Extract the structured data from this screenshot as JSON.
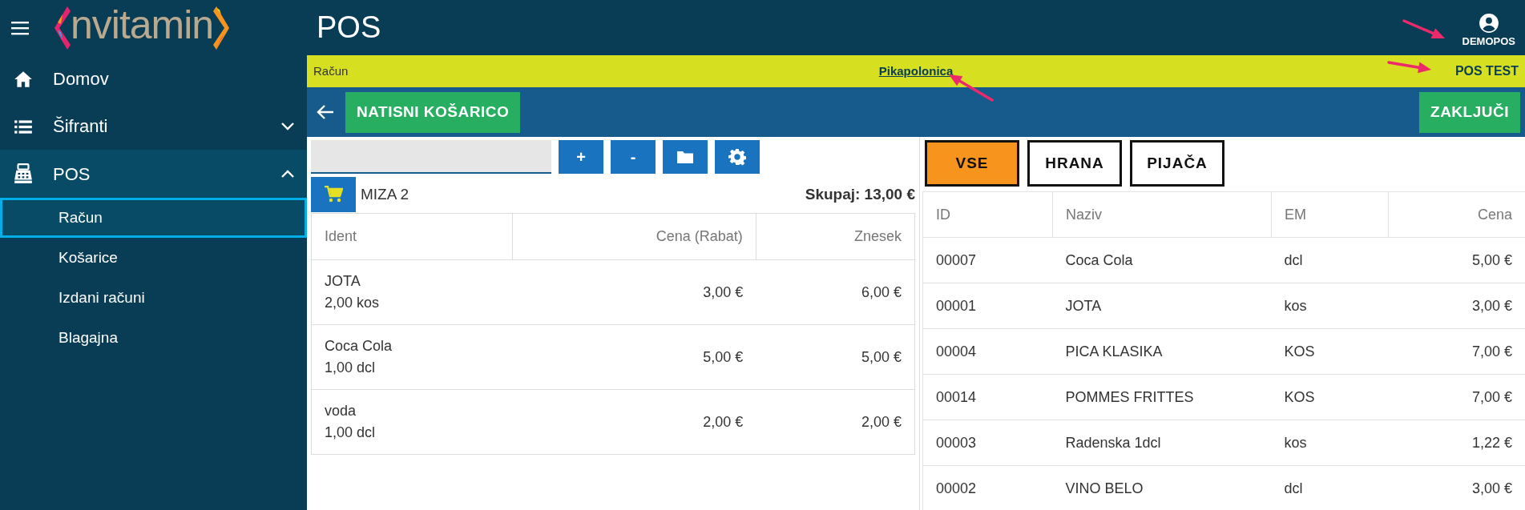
{
  "app_bar": {
    "logo": "nvitamin",
    "title": "POS",
    "user": "DEMOPOS"
  },
  "sidebar": {
    "items": [
      {
        "label": "Domov",
        "kind": "link"
      },
      {
        "label": "Šifranti",
        "kind": "group",
        "expanded": false
      },
      {
        "label": "POS",
        "kind": "group",
        "expanded": true,
        "children": [
          {
            "label": "Račun",
            "selected": true
          },
          {
            "label": "Košarice",
            "selected": false
          },
          {
            "label": "Izdani računi",
            "selected": false
          },
          {
            "label": "Blagajna",
            "selected": false
          }
        ]
      }
    ]
  },
  "info_bar": {
    "page": "Račun",
    "customer_link": "Pikapolonica",
    "register": "POS TEST"
  },
  "action_bar": {
    "print_button": "NATISNI KOŠARICO",
    "finish_button": "ZAKLJUČI"
  },
  "toolbar": {
    "buttons": [
      "+",
      "-"
    ]
  },
  "cart": {
    "table_name": "MIZA 2",
    "total": "Skupaj: 13,00 €",
    "columns": [
      "Ident",
      "Cena (Rabat)",
      "Znesek"
    ],
    "rows": [
      {
        "ident": "JOTA",
        "quantity": "2,00 kos",
        "price": "3,00 €",
        "amount": "6,00 €"
      },
      {
        "ident": "Coca Cola",
        "quantity": "1,00 dcl",
        "price": "5,00 €",
        "amount": "5,00 €"
      },
      {
        "ident": "voda",
        "quantity": "1,00 dcl",
        "price": "2,00 €",
        "amount": "2,00 €"
      }
    ]
  },
  "categories": [
    {
      "label": "VSE",
      "selected": true
    },
    {
      "label": "HRANA",
      "selected": false
    },
    {
      "label": "PIJAČA",
      "selected": false
    }
  ],
  "products": {
    "columns": [
      "ID",
      "Naziv",
      "EM",
      "Cena"
    ],
    "rows": [
      [
        "00007",
        "Coca Cola",
        "dcl",
        "5,00 €"
      ],
      [
        "00001",
        "JOTA",
        "kos",
        "3,00 €"
      ],
      [
        "00004",
        "PICA KLASIKA",
        "KOS",
        "7,00 €"
      ],
      [
        "00014",
        "POMMES FRITTES",
        "KOS",
        "7,00 €"
      ],
      [
        "00003",
        "Radenska 1dcl",
        "kos",
        "1,22 €"
      ],
      [
        "00002",
        "VINO BELO",
        "dcl",
        "3,00 €"
      ]
    ]
  }
}
